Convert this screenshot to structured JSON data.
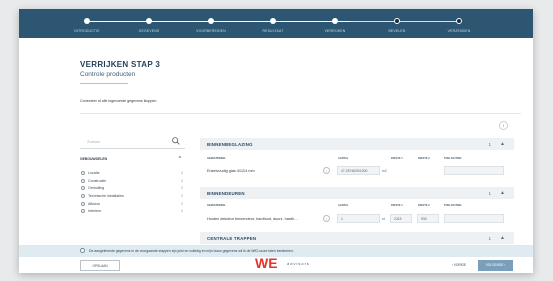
{
  "stepper": {
    "steps": [
      {
        "label": "INTRODUCTIE",
        "state": "done"
      },
      {
        "label": "GEGEVENS",
        "state": "done"
      },
      {
        "label": "VOORBEREIDEN",
        "state": "done"
      },
      {
        "label": "RESULTAAT",
        "state": "done"
      },
      {
        "label": "VERRIJKEN",
        "state": "active"
      },
      {
        "label": "BEVELEN",
        "state": "pending"
      },
      {
        "label": "VERZENDEN",
        "state": "pending"
      }
    ]
  },
  "header": {
    "title": "VERRIJKEN STAP 3",
    "subtitle": "Controle producten"
  },
  "intro_text": "Controleer of alle ingevoerde gegevens kloppen.",
  "help_symbol": "i",
  "sidebar": {
    "search_placeholder": "Zoeken",
    "categories_heading": "GEBOUWDELEN",
    "categories": [
      {
        "name": "Locatie",
        "count": "0"
      },
      {
        "name": "Constructie",
        "count": "0"
      },
      {
        "name": "Omhulling",
        "count": "0"
      },
      {
        "name": "Technische installaties",
        "count": "0"
      },
      {
        "name": "Afbouw",
        "count": "0"
      },
      {
        "name": "Interieur",
        "count": "0"
      }
    ]
  },
  "sections": [
    {
      "title": "BINNENBEGLAZING",
      "counter": "1",
      "columns": [
        "GEBOUWDEEL",
        "AANTAL",
        "DIKSTE 1",
        "DIKSTE 2",
        "TOELICHTING"
      ],
      "product": "Enkelvoudig glas 4/12/4 mm",
      "amount": "47,2574625/1000",
      "unit": "m2"
    },
    {
      "title": "BINNENDEUREN",
      "counter": "1",
      "columns": [
        "GEBOUWDEEL",
        "AANTAL",
        "DIKSTE 1",
        "DIKSTE 2",
        "TOELICHTING"
      ],
      "product": "Houten dekdeur binnendeur, hardhout, duurz. hardh...",
      "amount": "1",
      "unit": "st",
      "dim1": "2315",
      "dim2": "930"
    },
    {
      "title": "CENTRALE TRAPPEN",
      "counter": "1"
    }
  ],
  "notice_text": "De aangeleverde gegevens in de voorgaande stappen zijn juist en volledig en mijn bouw gegevens wil ik de WfG-score laten berekenen.",
  "footer": {
    "save_label": "OPSLAAN",
    "prev_label": "VORIGE",
    "next_label": "VOLGENDE",
    "logo_letters": "WE",
    "logo_tagline": "advisors"
  },
  "colors": {
    "stepper_bg": "#2c5672",
    "primary": "#1f3f58",
    "accent_red": "#e3342f",
    "next_button": "#7b9fbb"
  }
}
